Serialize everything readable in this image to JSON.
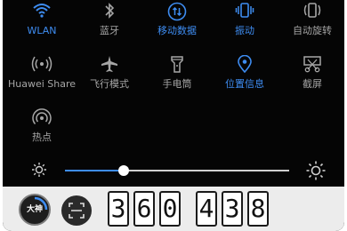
{
  "quick_settings": {
    "tiles": [
      {
        "label": "WLAN",
        "icon": "wifi-icon",
        "active": true
      },
      {
        "label": "蓝牙",
        "icon": "bluetooth-icon",
        "active": false
      },
      {
        "label": "移动数据",
        "icon": "mobile-data-icon",
        "active": true
      },
      {
        "label": "振动",
        "icon": "vibrate-icon",
        "active": true
      },
      {
        "label": "自动旋转",
        "icon": "auto-rotate-icon",
        "active": false
      },
      {
        "label": "Huawei Share",
        "icon": "huawei-share-icon",
        "active": false
      },
      {
        "label": "飞行模式",
        "icon": "airplane-icon",
        "active": false
      },
      {
        "label": "手电筒",
        "icon": "flashlight-icon",
        "active": false
      },
      {
        "label": "位置信息",
        "icon": "location-icon",
        "active": true
      },
      {
        "label": "截屏",
        "icon": "screenshot-icon",
        "active": false
      },
      {
        "label": "热点",
        "icon": "hotspot-icon",
        "active": false
      }
    ],
    "colors": {
      "active": "#3e8df2",
      "inactive": "#a6a6a6"
    }
  },
  "brightness": {
    "level": 0.26,
    "min_icon": "sun-small-icon",
    "max_icon": "sun-large-icon"
  },
  "bottom_bar": {
    "logo_text": "大神",
    "scan_icon": "scan-icon",
    "digits": [
      "3",
      "6",
      "0",
      "4",
      "3",
      "8"
    ]
  }
}
